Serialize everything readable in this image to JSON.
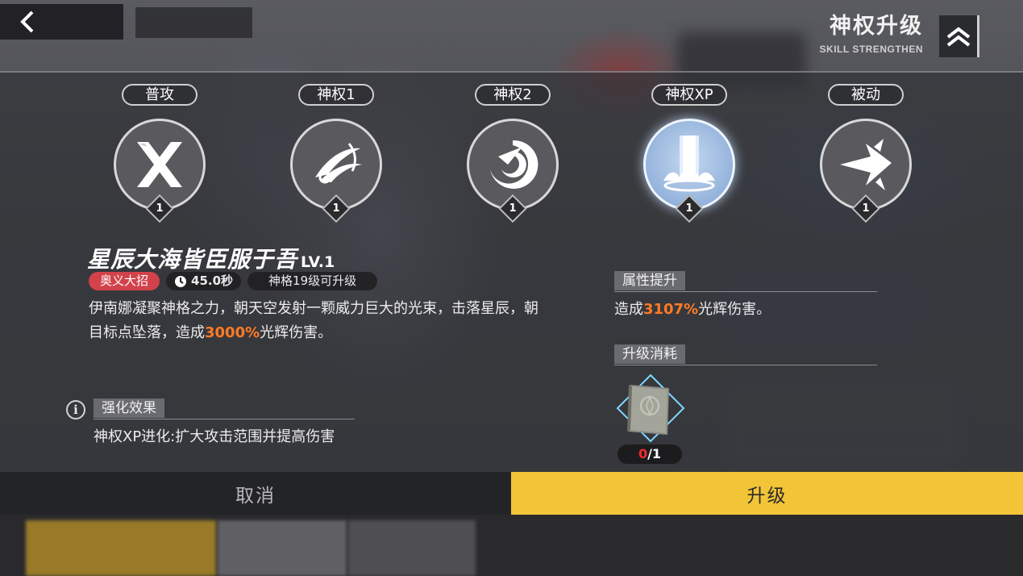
{
  "header": {
    "title": "神权升级",
    "subtitle": "SKILL STRENGTHEN"
  },
  "skills": [
    {
      "label": "普攻",
      "level": "1",
      "icon": "crossed-blades-icon"
    },
    {
      "label": "神权1",
      "level": "1",
      "icon": "claw-slash-icon"
    },
    {
      "label": "神权2",
      "level": "1",
      "icon": "vortex-slash-icon"
    },
    {
      "label": "神权XP",
      "level": "1",
      "icon": "light-pillar-icon"
    },
    {
      "label": "被动",
      "level": "1",
      "icon": "burst-arrow-icon"
    }
  ],
  "selected_skill": {
    "name": "星辰大海皆臣服于吾",
    "level_text": "LV.1",
    "tag_type": "奥义大招",
    "cooldown": "45.0秒",
    "requirement": "神格19级可升级",
    "desc_part1": "伊南娜凝聚神格之力，朝天空发射一颗威力巨大的光束，击落星辰，朝目标点坠落，造成",
    "desc_highlight": "3000%",
    "desc_part2": "光辉伤害。"
  },
  "enhance": {
    "header": "强化效果",
    "text": "神权XP进化:扩大攻击范围并提高伤害"
  },
  "attribute": {
    "header": "属性提升",
    "prefix": "造成",
    "highlight": "3107%",
    "suffix": "光辉伤害。"
  },
  "cost": {
    "header": "升级消耗",
    "owned": "0",
    "required": "/1",
    "item_icon": "skill-book-icon"
  },
  "buttons": {
    "cancel": "取消",
    "upgrade": "升级"
  },
  "colors": {
    "highlight": "#ff7a24",
    "upgrade_button": "#f2c437",
    "tag_red": "#d2424a"
  }
}
